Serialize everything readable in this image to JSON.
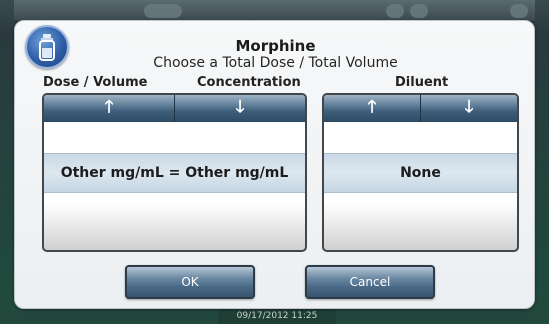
{
  "device": {
    "status_datetime": "09/17/2012 11:25"
  },
  "dialog": {
    "title": "Morphine",
    "subtitle": "Choose a Total Dose / Total Volume",
    "icon": "medication-vial-icon"
  },
  "columns": {
    "dose_volume_label": "Dose / Volume",
    "concentration_label": "Concentration",
    "diluent_label": "Diluent"
  },
  "pickers": {
    "concentration": {
      "selected_value": "Other mg/mL = Other mg/mL",
      "up_icon": "arrow-up-icon",
      "down_icon": "arrow-down-icon"
    },
    "diluent": {
      "selected_value": "None",
      "up_icon": "arrow-up-icon",
      "down_icon": "arrow-down-icon"
    }
  },
  "buttons": {
    "ok_label": "OK",
    "cancel_label": "Cancel"
  },
  "glyphs": {
    "up": "🡑",
    "down": "🡓"
  }
}
